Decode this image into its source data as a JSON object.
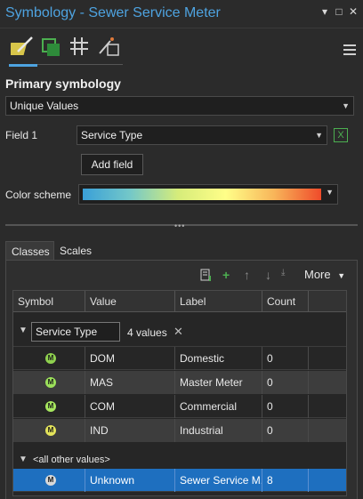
{
  "window": {
    "title": "Symbology - Sewer Service Meter",
    "controls": [
      "▾",
      "□",
      "✕"
    ]
  },
  "tools": [
    "primary-symbology",
    "vary-by-attribute",
    "label-classes",
    "illumination"
  ],
  "primary": {
    "heading": "Primary symbology",
    "method": "Unique Values",
    "field1_label": "Field 1",
    "field1_value": "Service Type",
    "add_field": "Add field",
    "color_scheme_label": "Color scheme"
  },
  "tabs": {
    "classes": "Classes",
    "scales": "Scales"
  },
  "toolbar": {
    "more": "More"
  },
  "table": {
    "headers": [
      "Symbol",
      "Value",
      "Label",
      "Count"
    ],
    "group": {
      "field": "Service Type",
      "count_text": "4 values",
      "clear": "✕"
    },
    "rows": [
      {
        "value": "DOM",
        "label": "Domestic",
        "count": "0",
        "color": "#8fd14f"
      },
      {
        "value": "MAS",
        "label": "Master Meter",
        "count": "0",
        "color": "#9be05a"
      },
      {
        "value": "COM",
        "label": "Commercial",
        "count": "0",
        "color": "#a6e65e"
      },
      {
        "value": "IND",
        "label": "Industrial",
        "count": "0",
        "color": "#e3e35a"
      }
    ],
    "others_label": "<all other values>",
    "other_row": {
      "value": "Unknown",
      "label": "Sewer Service M...",
      "count": "8",
      "color": "#d8d8d8"
    }
  },
  "symbol_glyph": "M"
}
